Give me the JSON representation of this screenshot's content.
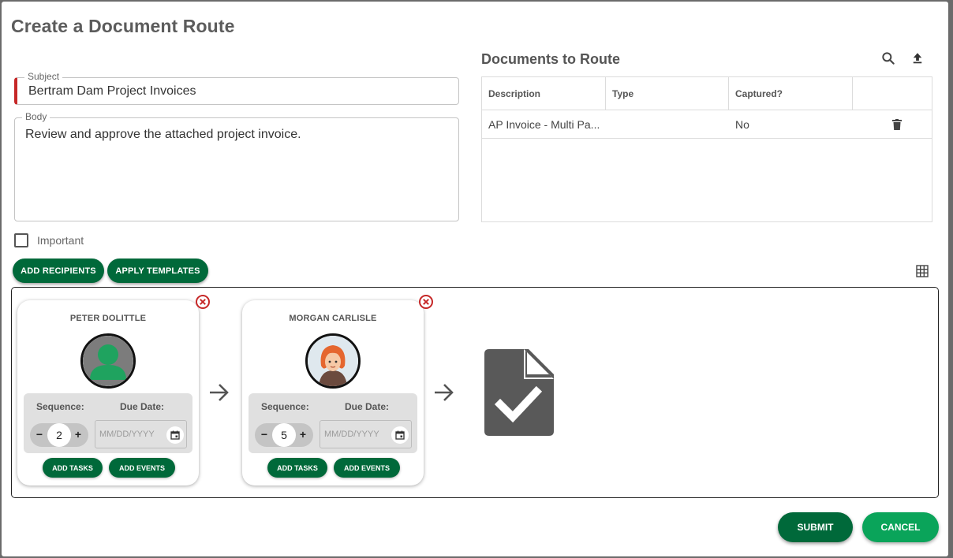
{
  "dialog": {
    "title": "Create a Document Route",
    "subject": {
      "label": "Subject",
      "value": "Bertram Dam Project Invoices"
    },
    "body": {
      "label": "Body",
      "value": "Review and approve the attached project invoice."
    },
    "important": {
      "label": "Important",
      "checked": false
    },
    "buttons": {
      "add_recipients": "ADD RECIPIENTS",
      "apply_templates": "APPLY TEMPLATES",
      "submit": "SUBMIT",
      "cancel": "CANCEL"
    }
  },
  "documents": {
    "title": "Documents to Route",
    "columns": [
      "Description",
      "Type",
      "Captured?",
      ""
    ],
    "rows": [
      {
        "description": "AP Invoice - Multi Pa...",
        "type": "",
        "captured": "No"
      }
    ]
  },
  "route": {
    "recipients": [
      {
        "name": "PETER DOLITTLE",
        "sequence_label": "Sequence:",
        "sequence": "2",
        "due_label": "Due Date:",
        "due_placeholder": "MM/DD/YYYY",
        "add_tasks": "ADD TASKS",
        "add_events": "ADD EVENTS",
        "avatar": "generic-person-avatar"
      },
      {
        "name": "MORGAN CARLISLE",
        "sequence_label": "Sequence:",
        "sequence": "5",
        "due_label": "Due Date:",
        "due_placeholder": "MM/DD/YYYY",
        "add_tasks": "ADD TASKS",
        "add_events": "ADD EVENTS",
        "avatar": "illustrated-woman-avatar"
      }
    ],
    "final_icon": "document-check-icon"
  },
  "colors": {
    "primary": "#00693a",
    "secondary": "#0aa45a",
    "danger": "#c62828"
  }
}
